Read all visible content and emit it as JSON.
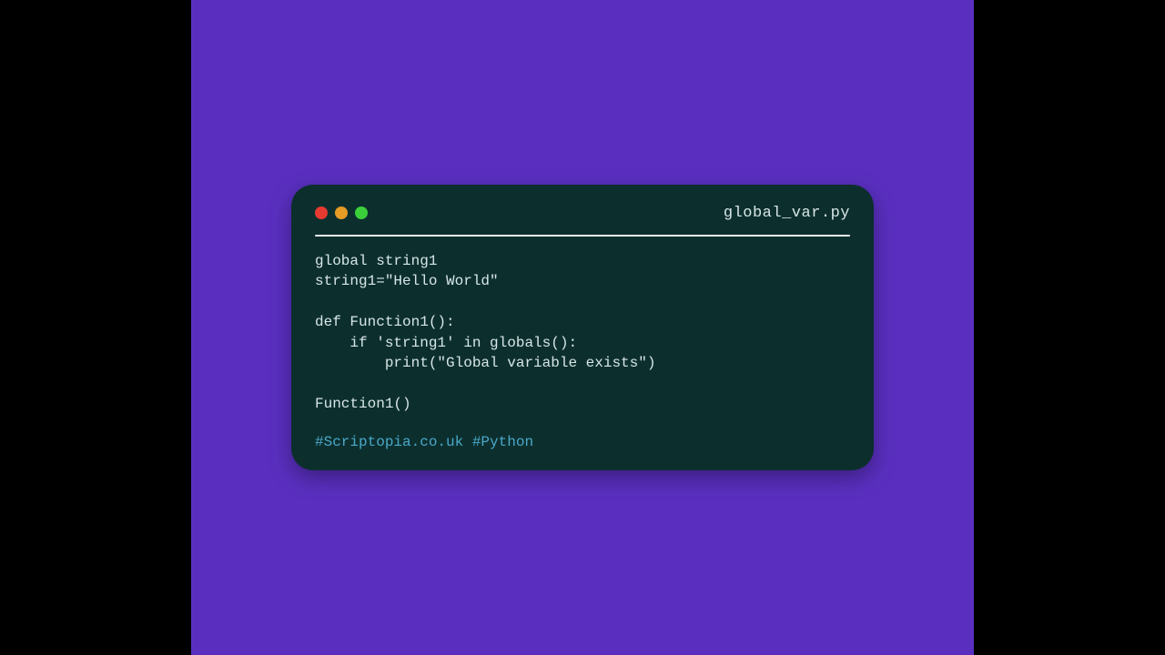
{
  "window": {
    "filename": "global_var.py",
    "traffic_lights": {
      "red": "#e73a31",
      "yellow": "#e59b24",
      "green": "#3bcf3b"
    }
  },
  "code": {
    "line1": "global string1",
    "line2": "string1=\"Hello World\"",
    "line3": "",
    "line4": "def Function1():",
    "line5": "    if 'string1' in globals():",
    "line6": "        print(\"Global variable exists\")",
    "line7": "",
    "line8": "Function1()"
  },
  "hashtags": "#Scriptopia.co.uk #Python"
}
